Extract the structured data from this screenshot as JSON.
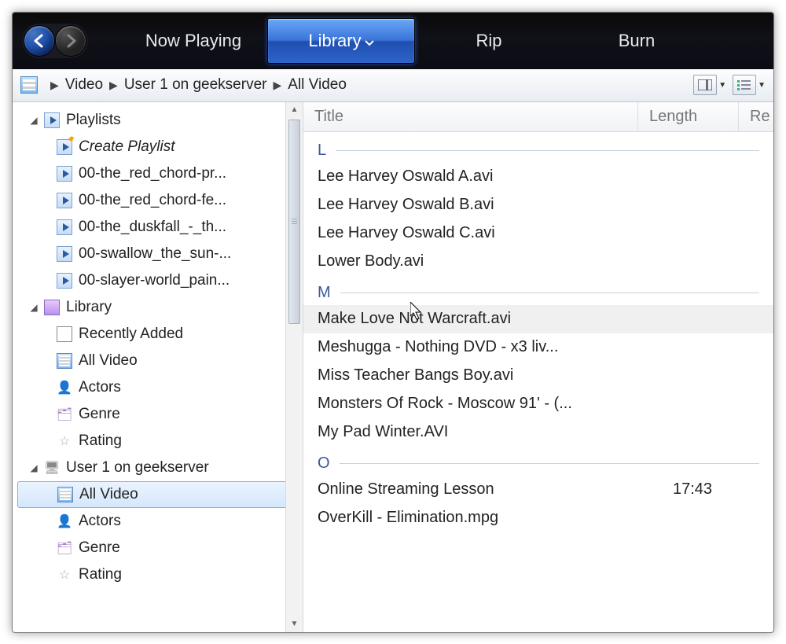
{
  "topbar": {
    "tabs": [
      {
        "label": "Now Playing"
      },
      {
        "label": "Library"
      },
      {
        "label": "Rip"
      },
      {
        "label": "Burn"
      }
    ],
    "active_tab": 1
  },
  "breadcrumb": [
    "Video",
    "User 1 on geekserver",
    "All Video"
  ],
  "sidebar": {
    "playlists": {
      "label": "Playlists",
      "create_label": "Create Playlist",
      "items": [
        "00-the_red_chord-pr...",
        "00-the_red_chord-fe...",
        "00-the_duskfall_-_th...",
        "00-swallow_the_sun-...",
        "00-slayer-world_pain..."
      ]
    },
    "library": {
      "label": "Library",
      "items": [
        "Recently Added",
        "All Video",
        "Actors",
        "Genre",
        "Rating"
      ]
    },
    "remote": {
      "label": "User 1 on geekserver",
      "items": [
        "All Video",
        "Actors",
        "Genre",
        "Rating"
      ],
      "selected": 0
    }
  },
  "columns": {
    "title": "Title",
    "length": "Length",
    "rest": "Re"
  },
  "groups": [
    {
      "letter": "L",
      "items": [
        {
          "title": "Lee Harvey Oswald A.avi"
        },
        {
          "title": "Lee Harvey Oswald B.avi"
        },
        {
          "title": "Lee Harvey Oswald C.avi"
        },
        {
          "title": "Lower Body.avi"
        }
      ]
    },
    {
      "letter": "M",
      "items": [
        {
          "title": "Make Love Not Warcraft.avi",
          "hover": true
        },
        {
          "title": "Meshugga    - Nothing DVD - x3 liv..."
        },
        {
          "title": "Miss Teacher Bangs Boy.avi"
        },
        {
          "title": "Monsters Of Rock - Moscow 91' - (..."
        },
        {
          "title": "My Pad Winter.AVI"
        }
      ]
    },
    {
      "letter": "O",
      "items": [
        {
          "title": "Online Streaming Lesson",
          "length": "17:43"
        },
        {
          "title": "OverKill - Elimination.mpg"
        }
      ]
    }
  ]
}
